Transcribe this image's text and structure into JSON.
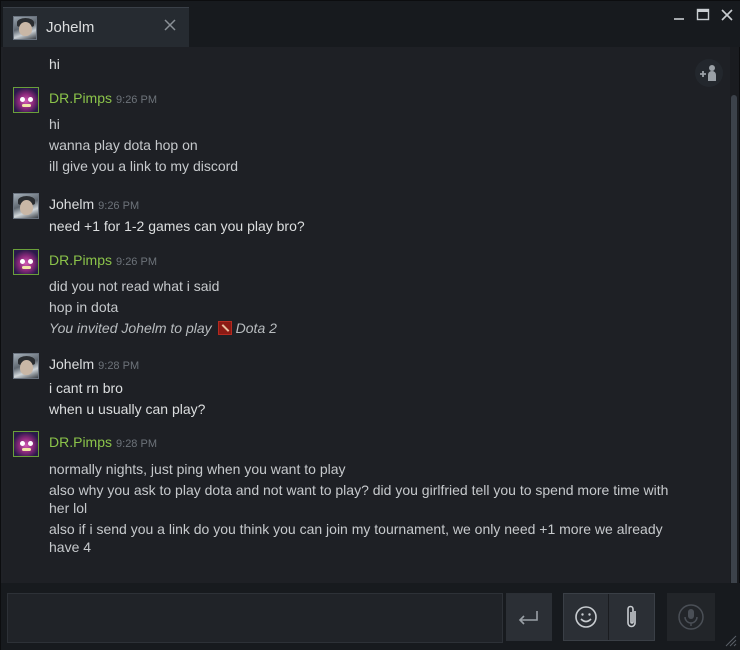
{
  "window": {
    "tab_title": "Johelm",
    "controls": [
      "minimize",
      "maximize",
      "close"
    ]
  },
  "chat": {
    "groups": [
      {
        "sender": "",
        "time": "",
        "avatar": "johelm-avatar",
        "lines": [
          "hi"
        ]
      },
      {
        "sender": "DR.Pimps",
        "time": "9:26 PM",
        "avatar": "drpimps-avatar",
        "lines": [
          "hi",
          "wanna play dota hop on",
          "ill give you a link to my discord"
        ]
      },
      {
        "sender": "Johelm",
        "time": "9:26 PM",
        "avatar": "johelm-avatar",
        "lines": [
          "need +1 for 1-2 games can you play bro?"
        ]
      },
      {
        "sender": "DR.Pimps",
        "time": "9:26 PM",
        "avatar": "drpimps-avatar",
        "lines": [
          "did you not read what i said",
          "hop in dota"
        ],
        "invite": {
          "text": "You invited Johelm to play",
          "game": "Dota 2"
        }
      },
      {
        "sender": "Johelm",
        "time": "9:28 PM",
        "avatar": "johelm-avatar",
        "lines": [
          "i cant rn bro",
          "when u usually can play?"
        ]
      },
      {
        "sender": "DR.Pimps",
        "time": "9:28 PM",
        "avatar": "drpimps-avatar",
        "lines": [
          "normally nights, just ping when you want to play",
          "also why you ask to play dota and not want to play? did you girlfried tell you to spend more time with her lol",
          "also if i send you a link do you think you can join my tournament, we only need +1 more we already have 4"
        ]
      }
    ]
  },
  "composer": {
    "input_value": "",
    "buttons": [
      "send",
      "emoticon",
      "attach",
      "voice"
    ]
  },
  "colors": {
    "friend_name": "#dcdedf",
    "ingame_name": "#8bc34a",
    "background": "#1e2025",
    "timestamp": "#6d737a"
  }
}
